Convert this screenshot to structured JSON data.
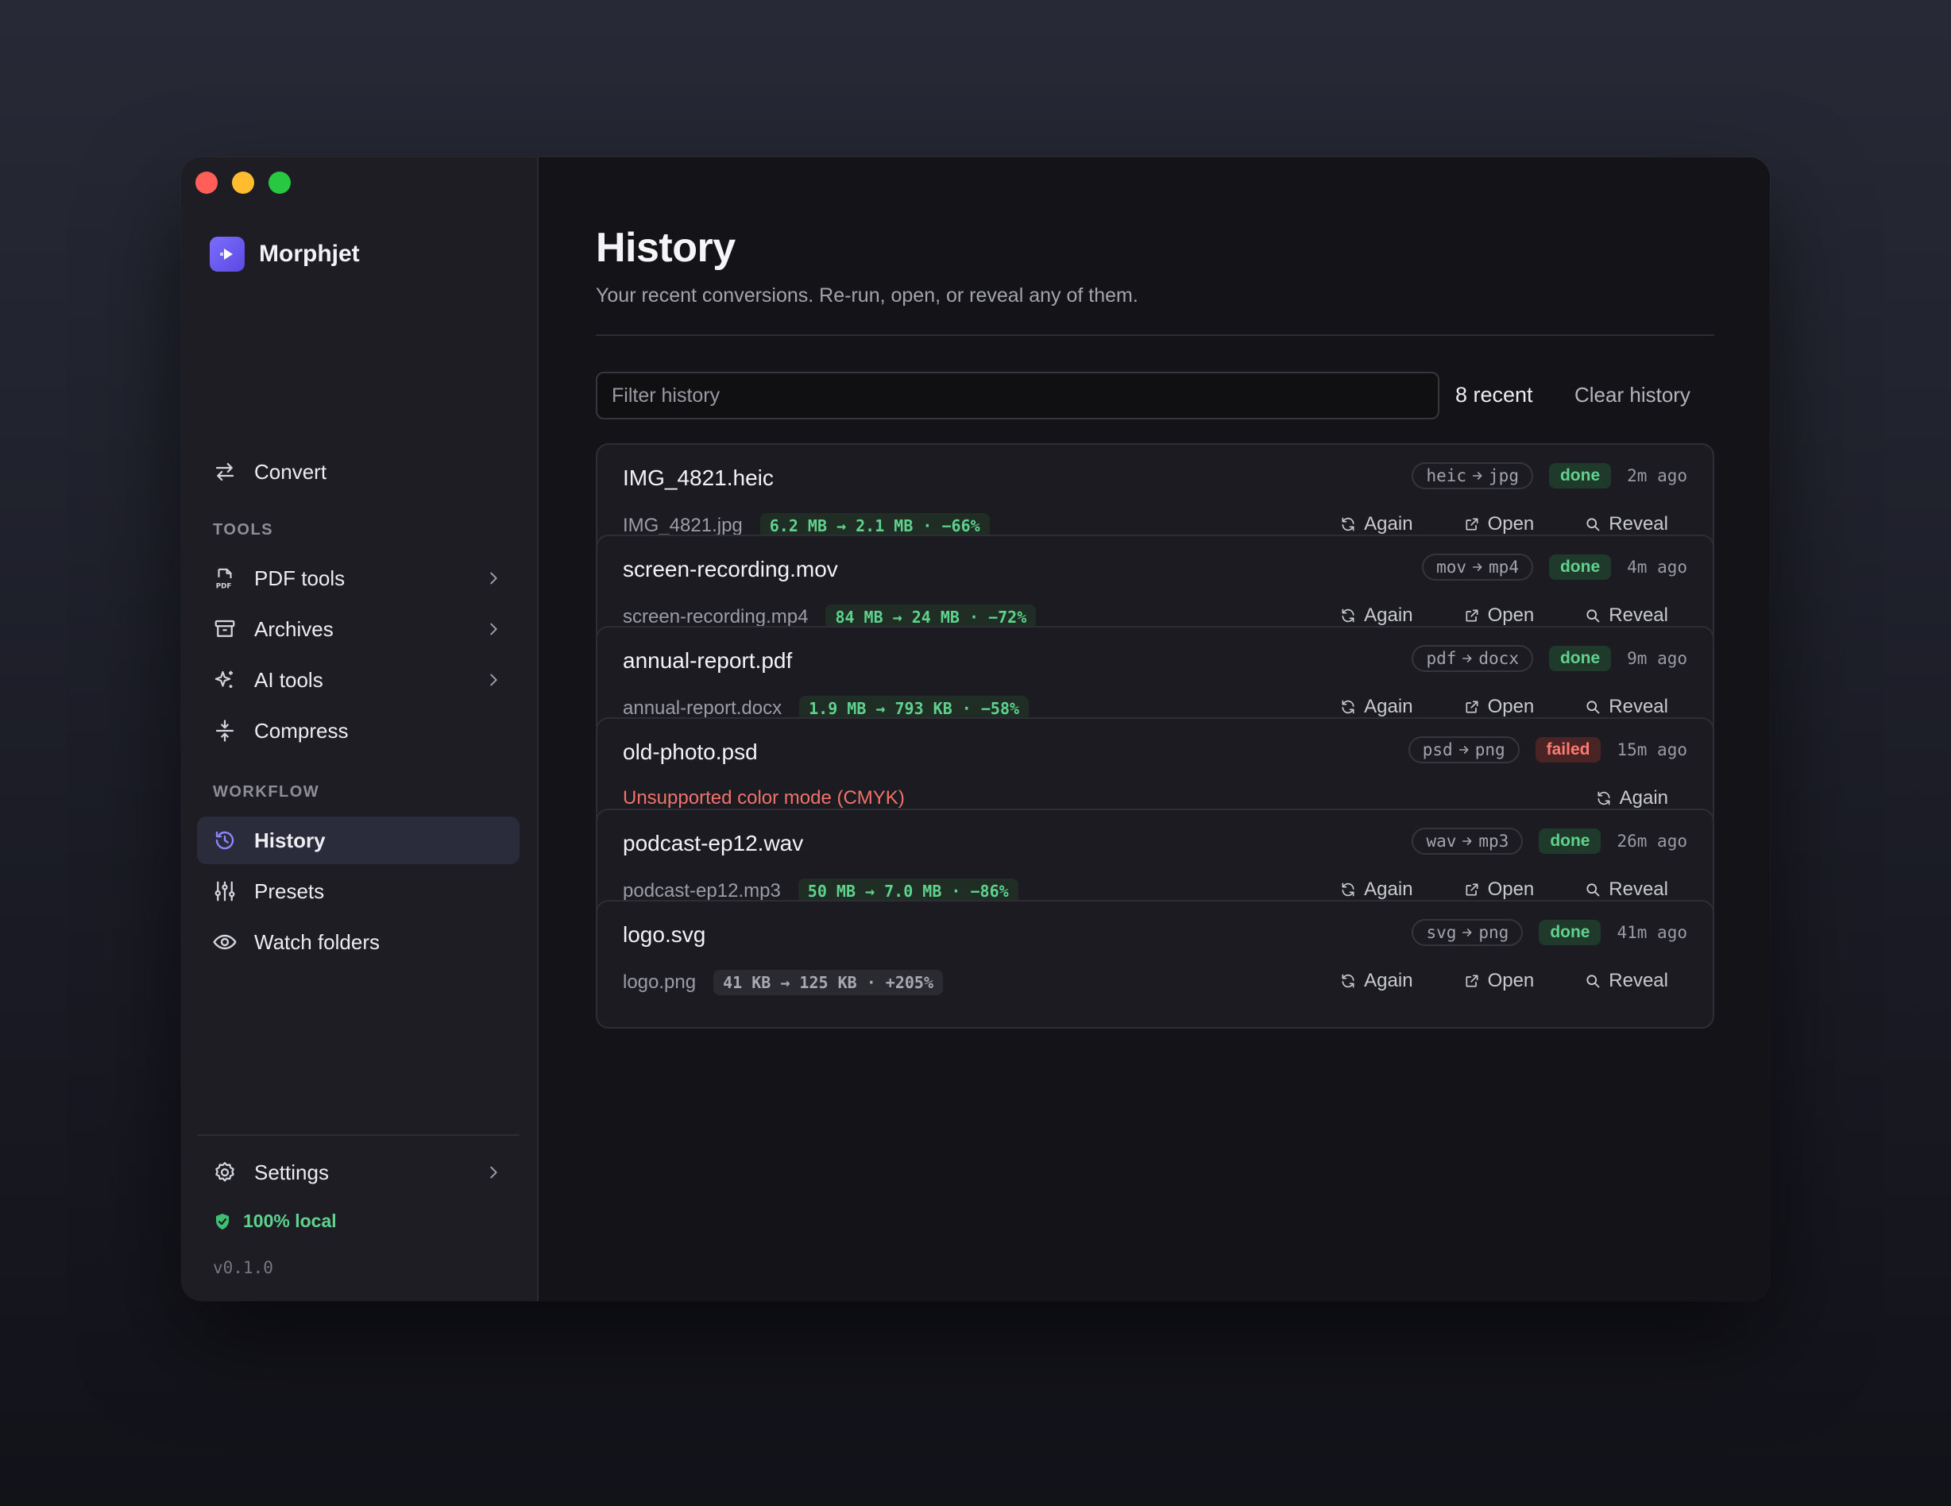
{
  "app": {
    "name": "Morphjet"
  },
  "sidebar": {
    "convert_label": "Convert",
    "tools_label": "TOOLS",
    "tools": [
      {
        "label": "PDF tools",
        "icon": "pdf-icon"
      },
      {
        "label": "Archives",
        "icon": "archive-icon"
      },
      {
        "label": "AI tools",
        "icon": "sparkle-icon"
      },
      {
        "label": "Compress",
        "icon": "compress-icon"
      }
    ],
    "workflow_label": "WORKFLOW",
    "workflow": [
      {
        "label": "History",
        "icon": "history-icon",
        "active": true
      },
      {
        "label": "Presets",
        "icon": "sliders-icon"
      },
      {
        "label": "Watch folders",
        "icon": "eye-icon"
      }
    ],
    "settings_label": "Settings",
    "local_label": "100% local",
    "version": "v0.1.0"
  },
  "main": {
    "title": "History",
    "subtitle": "Your recent conversions. Re-run, open, or reveal any of them.",
    "filter_placeholder": "Filter history",
    "recent_count": "8 recent",
    "clear_label": "Clear history",
    "actions": {
      "again": "Again",
      "open": "Open",
      "reveal": "Reveal"
    }
  },
  "history": [
    {
      "filename": "IMG_4821.heic",
      "from": "heic",
      "to": "jpg",
      "status": "done",
      "time": "2m ago",
      "output": "IMG_4821.jpg",
      "size": "6.2 MB → 2.1 MB · −66%"
    },
    {
      "filename": "screen-recording.mov",
      "from": "mov",
      "to": "mp4",
      "status": "done",
      "time": "4m ago",
      "output": "screen-recording.mp4",
      "size": "84 MB → 24 MB · −72%"
    },
    {
      "filename": "annual-report.pdf",
      "from": "pdf",
      "to": "docx",
      "status": "done",
      "time": "9m ago",
      "output": "annual-report.docx",
      "size": "1.9 MB → 793 KB · −58%"
    },
    {
      "filename": "old-photo.psd",
      "from": "psd",
      "to": "png",
      "status": "failed",
      "time": "15m ago",
      "error": "Unsupported color mode (CMYK)"
    },
    {
      "filename": "podcast-ep12.wav",
      "from": "wav",
      "to": "mp3",
      "status": "done",
      "time": "26m ago",
      "output": "podcast-ep12.mp3",
      "size": "50 MB → 7.0 MB · −86%"
    },
    {
      "filename": "logo.svg",
      "from": "svg",
      "to": "png",
      "status": "done",
      "time": "41m ago",
      "output": "logo.png",
      "size": "41 KB → 125 KB · +205%"
    }
  ],
  "colors": {
    "accent": "#6b5cf0",
    "success": "#5fd38d",
    "error": "#f07268",
    "sidebar": "#1d1d23",
    "background": "#141418"
  }
}
